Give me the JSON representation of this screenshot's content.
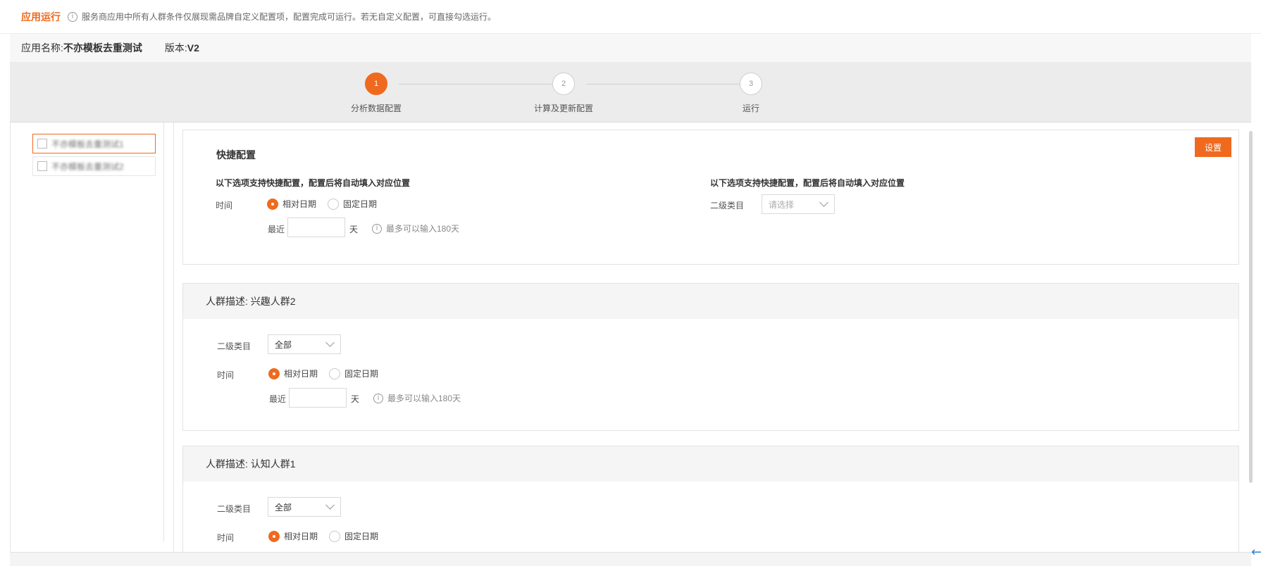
{
  "header": {
    "title": "应用运行",
    "notice": "服务商应用中所有人群条件仅展现需品牌自定义配置项，配置完成可运行。若无自定义配置，可直接勾选运行。"
  },
  "app": {
    "name_label": "应用名称:",
    "name_value": "不亦模板去重测试",
    "version_label": "版本:",
    "version_value": "V2"
  },
  "steps": [
    {
      "num": "1",
      "label": "分析数据配置",
      "active": true
    },
    {
      "num": "2",
      "label": "计算及更新配置",
      "active": false
    },
    {
      "num": "3",
      "label": "运行",
      "active": false
    }
  ],
  "sidebar": {
    "items": [
      {
        "label": "不亦模板去重测试1",
        "selected": true
      },
      {
        "label": "不亦模板去重测试2",
        "selected": false
      }
    ]
  },
  "quick": {
    "title": "快捷配置",
    "subtitle_left": "以下选项支持快捷配置，配置后将自动填入对应位置",
    "subtitle_right": "以下选项支持快捷配置，配置后将自动填入对应位置",
    "time_label": "时间",
    "radio_relative": "相对日期",
    "radio_fixed": "固定日期",
    "recent_label": "最近",
    "day_unit": "天",
    "hint": "最多可以输入180天",
    "category_label": "二级类目",
    "category_placeholder": "请选择",
    "set_button": "设置"
  },
  "groups": [
    {
      "heading": "人群描述:  兴趣人群2",
      "category_label": "二级类目",
      "category_value": "全部",
      "time_label": "时间",
      "radio_relative": "相对日期",
      "radio_fixed": "固定日期",
      "recent_label": "最近",
      "day_unit": "天",
      "hint": "最多可以输入180天"
    },
    {
      "heading": "人群描述:  认知人群1",
      "category_label": "二级类目",
      "category_value": "全部",
      "time_label": "时间",
      "radio_relative": "相对日期",
      "radio_fixed": "固定日期"
    }
  ],
  "colors": {
    "accent": "#ef6a1f"
  }
}
